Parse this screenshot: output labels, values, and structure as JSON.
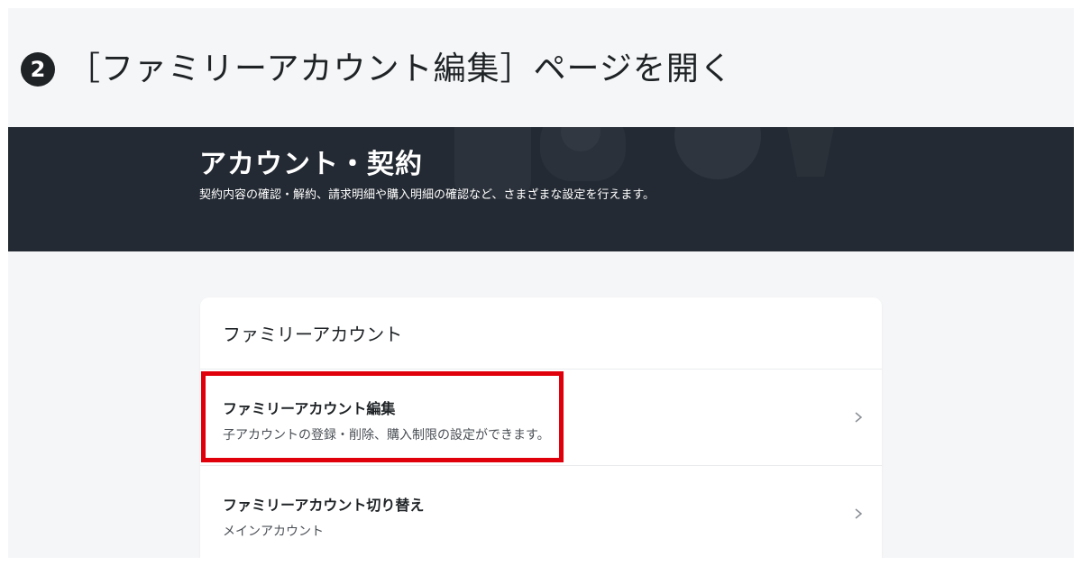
{
  "step": {
    "badge": "2",
    "text": "［ファミリーアカウント編集］ページを開く"
  },
  "hero": {
    "title": "アカウント・契約",
    "description": "契約内容の確認・解約、請求明細や購入明細の確認など、さまざまな設定を行えます。"
  },
  "card": {
    "header": "ファミリーアカウント",
    "items": [
      {
        "title": "ファミリーアカウント編集",
        "subtitle": "子アカウントの登録・削除、購入制限の設定ができます。"
      },
      {
        "title": "ファミリーアカウント切り替え",
        "subtitle": "メインアカウント"
      }
    ]
  },
  "colors": {
    "hero_bg": "#242a33",
    "page_bg": "#f5f6f7",
    "highlight": "#e0000b"
  },
  "icons": {
    "chevron": "chevron-right-icon",
    "badge": "number-2-circle-icon"
  }
}
